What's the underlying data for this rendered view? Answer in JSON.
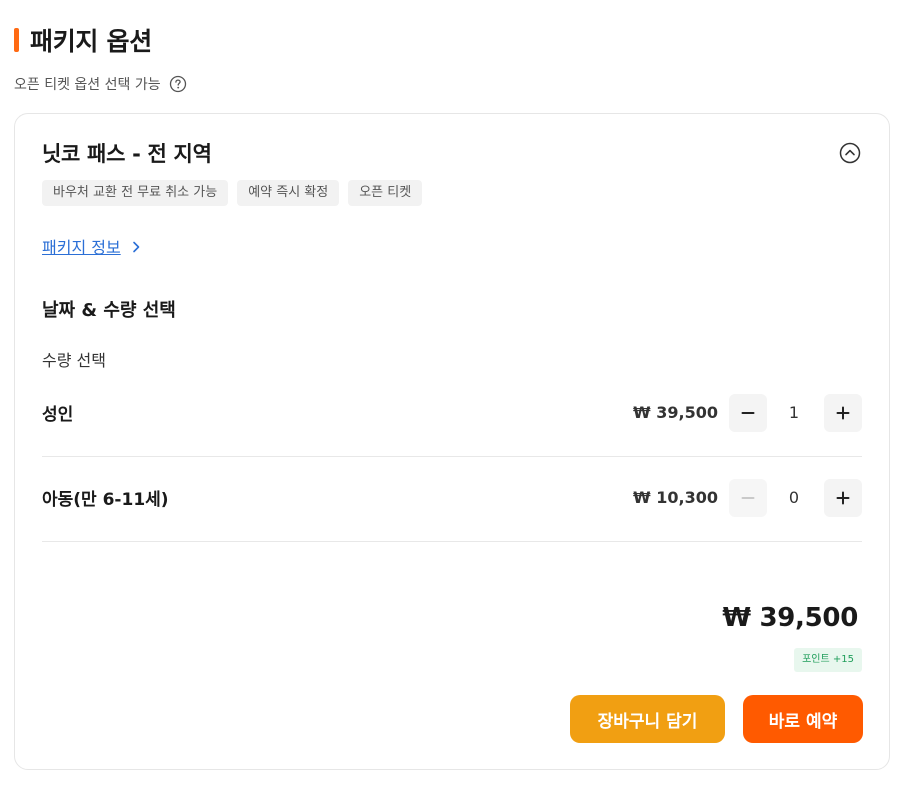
{
  "section": {
    "title": "패키지 옵션",
    "subtitle": "오픈 티켓 옵션 선택 가능"
  },
  "package": {
    "title": "닛코 패스 - 전 지역",
    "tags": [
      "바우처 교환 전 무료 취소 가능",
      "예약 즉시 확정",
      "오픈 티켓"
    ],
    "info_link": "패키지 정보"
  },
  "selection": {
    "title": "날짜 & 수량 선택",
    "quantity_label": "수량 선택",
    "rows": [
      {
        "label": "성인",
        "price": "₩ 39,500",
        "count": "1"
      },
      {
        "label": "아동(만 6-11세)",
        "price": "₩ 10,300",
        "count": "0"
      }
    ]
  },
  "summary": {
    "total": "₩ 39,500",
    "points": "포인트 +15"
  },
  "actions": {
    "cart_label": "장바구니 담기",
    "book_label": "바로 예약"
  },
  "colors": {
    "accent": "#ff6a13",
    "cart_button": "#f19f12",
    "book_button": "#ff5a00",
    "link": "#2b6fd6",
    "points_text": "#1f9e5a"
  },
  "icons": {
    "help": "question-circle-icon",
    "collapse": "chevron-up-circle-icon",
    "link_chevron": "chevron-right-icon",
    "minus": "minus-icon",
    "plus": "plus-icon"
  }
}
